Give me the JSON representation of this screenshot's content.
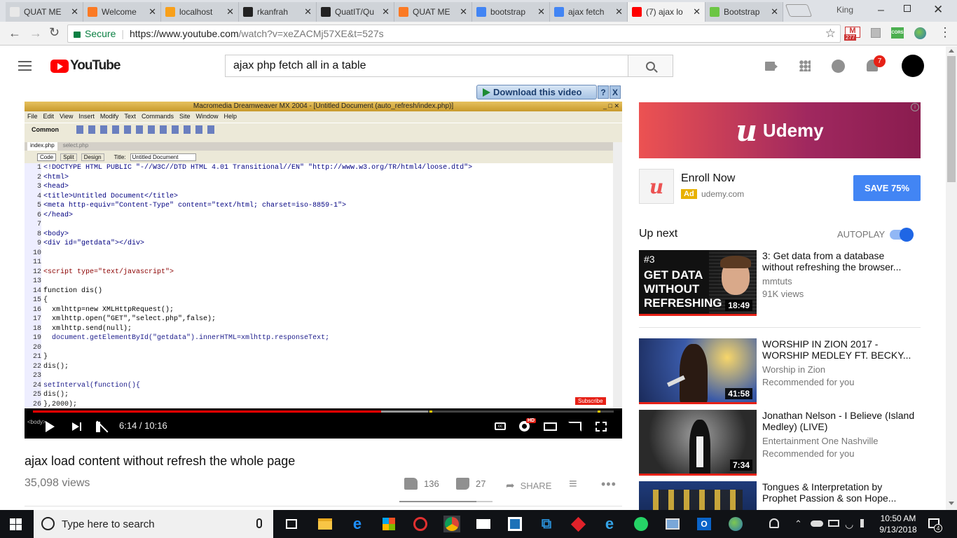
{
  "browser": {
    "tabs": [
      {
        "label": "QUAT ME",
        "icon": "document-icon",
        "color": "#e8e8e8"
      },
      {
        "label": "Welcome",
        "icon": "xampp-icon",
        "color": "#fb7a24"
      },
      {
        "label": "localhost",
        "icon": "phpmyadmin-icon",
        "color": "#f8a01a"
      },
      {
        "label": "rkanfrah",
        "icon": "github-icon",
        "color": "#222222"
      },
      {
        "label": "QuatIT/Qu",
        "icon": "github-icon",
        "color": "#222222"
      },
      {
        "label": "QUAT ME",
        "icon": "xampp-icon",
        "color": "#fb7a24"
      },
      {
        "label": "bootstrap",
        "icon": "google-icon",
        "color": "#4285f4"
      },
      {
        "label": "ajax fetch",
        "icon": "google-icon",
        "color": "#4285f4"
      },
      {
        "label": "(7) ajax lo",
        "icon": "youtube-icon",
        "color": "#ff0000"
      },
      {
        "label": "Bootstrap",
        "icon": "bootsnipp-icon",
        "color": "#6cc644"
      }
    ],
    "profile_name": "King",
    "secure_label": "Secure",
    "url_base": "https://www.youtube.com",
    "url_path": "/watch?v=xeZACMj57XE&t=527s",
    "gmail_badge": "277"
  },
  "youtube": {
    "logo_text": "YouTube",
    "search_query": "ajax php fetch all in a table",
    "notification_count": "7",
    "download_label": "Download this video"
  },
  "player": {
    "dw_title": "Macromedia Dreamweaver MX 2004 - [Untitled Document (auto_refresh/index.php)]",
    "menu": [
      "File",
      "Edit",
      "View",
      "Insert",
      "Modify",
      "Text",
      "Commands",
      "Site",
      "Window",
      "Help"
    ],
    "insert_bar": "Common",
    "doc_tabs": [
      "index.php",
      "select.php"
    ],
    "view_buttons": [
      "Code",
      "Split",
      "Design"
    ],
    "title_label": "Title:",
    "title_value": "Untitled Document",
    "code_lines": [
      {
        "n": "1",
        "t": "<!DOCTYPE HTML PUBLIC \"-//W3C//DTD HTML 4.01 Transitional//EN\" \"http://www.w3.org/TR/html4/loose.dtd\">"
      },
      {
        "n": "2",
        "t": "<html>"
      },
      {
        "n": "3",
        "t": "<head>"
      },
      {
        "n": "4",
        "t": "<title>Untitled Document</title>"
      },
      {
        "n": "5",
        "t": "<meta http-equiv=\"Content-Type\" content=\"text/html; charset=iso-8859-1\">"
      },
      {
        "n": "6",
        "t": "</head>"
      },
      {
        "n": "7",
        "t": ""
      },
      {
        "n": "8",
        "t": "<body>"
      },
      {
        "n": "9",
        "t": "<div id=\"getdata\"></div>"
      },
      {
        "n": "10",
        "t": ""
      },
      {
        "n": "11",
        "t": ""
      },
      {
        "n": "12",
        "t": "<script type=\"text/javascript\">"
      },
      {
        "n": "13",
        "t": ""
      },
      {
        "n": "14",
        "t": "function dis()"
      },
      {
        "n": "15",
        "t": "{"
      },
      {
        "n": "16",
        "t": "  xmlhttp=new XMLHttpRequest();"
      },
      {
        "n": "17",
        "t": "  xmlhttp.open(\"GET\",\"select.php\",false);"
      },
      {
        "n": "18",
        "t": "  xmlhttp.send(null);"
      },
      {
        "n": "19",
        "t": "  document.getElementById(\"getdata\").innerHTML=xmlhttp.responseText;"
      },
      {
        "n": "20",
        "t": ""
      },
      {
        "n": "21",
        "t": "}"
      },
      {
        "n": "22",
        "t": "dis();"
      },
      {
        "n": "23",
        "t": ""
      },
      {
        "n": "24",
        "t": "setInterval(function(){"
      },
      {
        "n": "25",
        "t": "dis();"
      },
      {
        "n": "26",
        "t": "},2000);"
      }
    ],
    "subscribe_label": "Subscribe",
    "time": "6:14 / 10:16",
    "progress": 0.6,
    "buffered": 0.68,
    "status_tag": "<body>",
    "hd_badge": "HD"
  },
  "video": {
    "title": "ajax load content without refresh the whole page",
    "views": "35,098 views",
    "likes": "136",
    "dislikes": "27",
    "share_label": "SHARE",
    "like_ratio": 0.83
  },
  "ad": {
    "brand": "Udemy",
    "headline": "Enroll Now",
    "ad_label": "Ad",
    "domain": "udemy.com",
    "cta": "SAVE 75%"
  },
  "sidebar": {
    "up_next": "Up next",
    "autoplay": "AUTOPLAY",
    "videos": [
      {
        "title": "3: Get data from a database without refreshing the browser...",
        "channel": "mmtuts",
        "meta": "91K views",
        "duration": "18:49",
        "thumb_text": [
          "#3",
          "GET DATA",
          "WITHOUT",
          "REFRESHING"
        ]
      },
      {
        "title": "WORSHIP IN ZION 2017 - WORSHIP MEDLEY FT. BECKY...",
        "channel": "Worship in Zion",
        "meta": "Recommended for you",
        "duration": "41:58"
      },
      {
        "title": "Jonathan Nelson - I Believe (Island Medley) (LIVE)",
        "channel": "Entertainment One Nashville",
        "meta": "Recommended for you",
        "duration": "7:34"
      },
      {
        "title": "Tongues & Interpretation by Prophet Passion & son Hope...",
        "channel": "",
        "meta": "",
        "duration": ""
      }
    ]
  },
  "taskbar": {
    "search_placeholder": "Type here to search",
    "time": "10:50 AM",
    "date": "9/13/2018",
    "notif_count": "4"
  }
}
